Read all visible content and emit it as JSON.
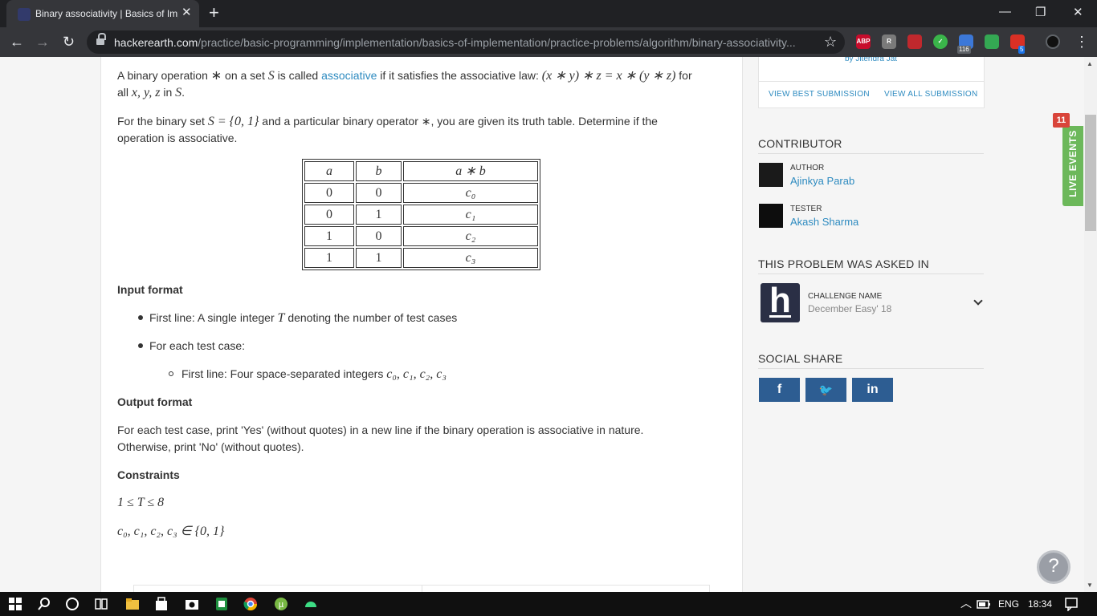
{
  "browser": {
    "tab_title": "Binary associativity | Basics of Imp",
    "tab_close": "✕",
    "new_tab": "+",
    "window_controls": {
      "minimize": "—",
      "maximize": "❐",
      "close": "✕"
    },
    "nav": {
      "back": "←",
      "forward": "→",
      "reload": "↻"
    },
    "url_host": "hackerearth.com",
    "url_path": "/practice/basic-programming/implementation/basics-of-implementation/practice-problems/algorithm/binary-associativity...",
    "bookmark_star": "☆",
    "extensions": [
      {
        "name": "abp-icon",
        "label": "ABP",
        "color": "#c70d2c"
      },
      {
        "name": "extension-gray-icon",
        "label": "R",
        "color": "#7a7a7a"
      },
      {
        "name": "extension-red-icon",
        "label": "",
        "color": "#c0282d"
      },
      {
        "name": "check-icon",
        "label": "✓",
        "color": "#3ab54a"
      },
      {
        "name": "calendar-icon",
        "label": "",
        "color": "#3c78d8"
      },
      {
        "name": "google-icon",
        "label": "",
        "color": "#34a853"
      },
      {
        "name": "extension-counter-icon",
        "label": "",
        "color": "#d93025"
      }
    ],
    "ext_badges": {
      "calendar": "116",
      "counter": "5"
    },
    "menu": "⋮"
  },
  "problem": {
    "p1": {
      "a": "A binary operation ",
      "op": "∗",
      "b": " on a set ",
      "S": "S",
      "c": " is called ",
      "link": "associative",
      "d": " if it satisfies the associative law: ",
      "law": "(x ∗ y) ∗ z = x ∗ (y ∗ z)",
      "e": " for",
      "f": "all ",
      "vars": "x, y, z",
      "g": " in ",
      "S2": "S",
      "h": "."
    },
    "p2": {
      "a": "For the binary set ",
      "set": "S = {0, 1}",
      "b": " and a particular binary operator ∗, you are given its truth table. Determine if the",
      "c": "operation is associative."
    },
    "table": {
      "headers": [
        "a",
        "b",
        "a ∗ b"
      ],
      "rows": [
        [
          "0",
          "0",
          "c₀"
        ],
        [
          "0",
          "1",
          "c₁"
        ],
        [
          "1",
          "0",
          "c₂"
        ],
        [
          "1",
          "1",
          "c₃"
        ]
      ]
    },
    "input_heading": "Input format",
    "input_line1_a": "First line: A single integer ",
    "input_line1_var": "T",
    "input_line1_b": " denoting the number of test cases",
    "input_line2": "For each test case:",
    "input_line3_a": "First line: Four space-separated integers ",
    "input_line3_vars": "c₀, c₁, c₂, c₃",
    "output_heading": "Output format",
    "output_line1": "For each test case, print 'Yes' (without quotes) in a new line if the binary operation is associative in nature.",
    "output_line2": "Otherwise, print 'No' (without quotes).",
    "constraints_heading": "Constraints",
    "constraint1": "1 ≤ T ≤ 8",
    "constraint2": "c₀, c₁, c₂, c₃ ∈ {0, 1}"
  },
  "sidebar": {
    "by_line": "by Jitendra Jat",
    "view_best": "VIEW BEST SUBMISSION",
    "view_all": "VIEW ALL SUBMISSION",
    "contributor_heading": "CONTRIBUTOR",
    "author_role": "AUTHOR",
    "author_name": "Ajinkya Parab",
    "tester_role": "TESTER",
    "tester_name": "Akash Sharma",
    "asked_heading": "THIS PROBLEM WAS ASKED IN",
    "challenge_label": "CHALLENGE NAME",
    "challenge_value": "December Easy' 18",
    "social_heading": "SOCIAL SHARE",
    "social": {
      "facebook": "f",
      "twitter": "🐦",
      "linkedin": "in"
    },
    "live_events": "LIVE EVENTS",
    "live_count": "11",
    "help": "?"
  },
  "taskbar": {
    "lang": "ENG",
    "time": "18:34",
    "chevron": "︿"
  }
}
